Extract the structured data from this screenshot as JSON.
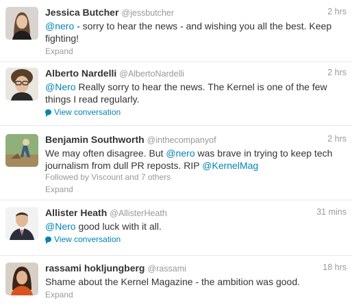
{
  "colors": {
    "link": "#0084b4",
    "secondary": "#999999",
    "text": "#333333",
    "divider": "#e8e8e8"
  },
  "tweets": [
    {
      "fullname": "Jessica Butcher",
      "username": "@jessbutcher",
      "time": "2 hrs",
      "mention": "@nero",
      "text_before": "",
      "text_after": " - sorry to hear the news - and wishing you all the best. Keep fighting!",
      "action": "Expand"
    },
    {
      "fullname": "Alberto Nardelli",
      "username": "@AlbertoNardelli",
      "time": "2 hrs",
      "mention": "@Nero",
      "text_before": "",
      "text_after": " Really sorry to hear the news. The Kernel is one of the few things I read regularly.",
      "action": "View conversation",
      "action_icon": "conversation-icon"
    },
    {
      "fullname": "Benjamin Southworth",
      "username": "@inthecompanyof",
      "time": "2 hrs",
      "mention": "@nero",
      "text_before": "We may often disagree. But ",
      "text_mid": " was brave in trying to keep tech journalism from dull PR reposts. RIP ",
      "mention2": "@KernelMag",
      "followed_by": "Followed by Viscount and 7 others",
      "action": "Expand"
    },
    {
      "fullname": "Allister Heath",
      "username": "@AllisterHeath",
      "time": "31 mins",
      "mention": "@Nero",
      "text_before": "",
      "text_after": " good luck with it all.",
      "action": "View conversation",
      "action_icon": "conversation-icon"
    },
    {
      "fullname": "rassami hokljungberg",
      "username": "@rassami",
      "time": "18 hrs",
      "text": "Shame about the Kernel Magazine - the ambition was good.",
      "action": "Expand"
    }
  ]
}
